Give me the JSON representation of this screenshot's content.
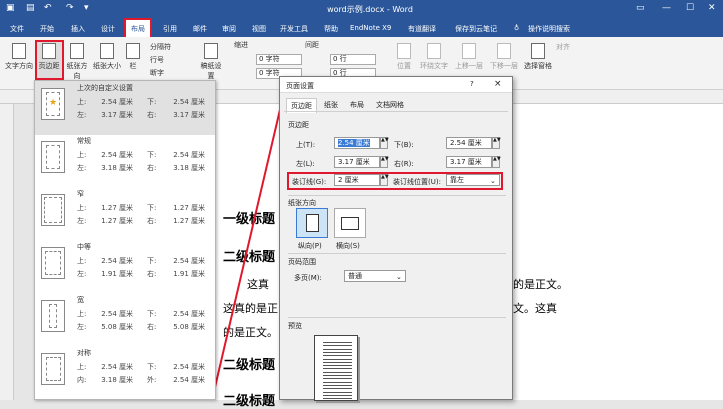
{
  "window": {
    "title": "word示例.docx  -  Word"
  },
  "tabs": [
    "文件",
    "开始",
    "插入",
    "设计",
    "布局",
    "引用",
    "邮件",
    "审阅",
    "视图",
    "开发工具",
    "帮助",
    "EndNote X9",
    "有道翻译",
    "保存到云笔记",
    "操作说明搜索"
  ],
  "active_tab": "布局",
  "ribbon": {
    "text_direction": "文字方向",
    "margins": "页边距",
    "orientation": "纸张方向",
    "size": "纸张大小",
    "columns": "栏",
    "breaks": "分隔符",
    "line_numbers": "行号",
    "hyphenation": "断字",
    "manuscript": "稿纸设置",
    "indent": "缩进",
    "spacing": "间距",
    "indent_left": "0 字符",
    "indent_right": "0 字符",
    "spacing_before": "0 行",
    "spacing_after": "0 行",
    "position": "位置",
    "wrap": "环绕文字",
    "bring_forward": "上移一层",
    "send_backward": "下移一层",
    "selection_pane": "选择窗格",
    "align": "对齐"
  },
  "margin_presets": [
    {
      "name": "上次的自定义设置",
      "top_l": "上:",
      "top": "2.54 厘米",
      "bottom_l": "下:",
      "bottom": "2.54 厘米",
      "left_l": "左:",
      "left": "3.17 厘米",
      "right_l": "右:",
      "right": "3.17 厘米"
    },
    {
      "name": "常规",
      "top_l": "上:",
      "top": "2.54 厘米",
      "bottom_l": "下:",
      "bottom": "2.54 厘米",
      "left_l": "左:",
      "left": "3.18 厘米",
      "right_l": "右:",
      "right": "3.18 厘米"
    },
    {
      "name": "窄",
      "top_l": "上:",
      "top": "1.27 厘米",
      "bottom_l": "下:",
      "bottom": "1.27 厘米",
      "left_l": "左:",
      "left": "1.27 厘米",
      "right_l": "右:",
      "right": "1.27 厘米"
    },
    {
      "name": "中等",
      "top_l": "上:",
      "top": "2.54 厘米",
      "bottom_l": "下:",
      "bottom": "2.54 厘米",
      "left_l": "左:",
      "left": "1.91 厘米",
      "right_l": "右:",
      "right": "1.91 厘米"
    },
    {
      "name": "宽",
      "top_l": "上:",
      "top": "2.54 厘米",
      "bottom_l": "下:",
      "bottom": "2.54 厘米",
      "left_l": "左:",
      "left": "5.08 厘米",
      "right_l": "右:",
      "right": "5.08 厘米"
    },
    {
      "name": "对称",
      "top_l": "上:",
      "top": "2.54 厘米",
      "bottom_l": "下:",
      "bottom": "2.54 厘米",
      "left_l": "内:",
      "left": "3.18 厘米",
      "right_l": "外:",
      "right": "2.54 厘米"
    }
  ],
  "dialog": {
    "title": "页面设置",
    "help": "?",
    "close": "×",
    "tabs": [
      "页边距",
      "纸张",
      "布局",
      "文档网格"
    ],
    "margins_group": "页边距",
    "top_label": "上(T):",
    "top_value": "2.54 厘米",
    "bottom_label": "下(B):",
    "bottom_value": "2.54 厘米",
    "left_label": "左(L):",
    "left_value": "3.17 厘米",
    "right_label": "右(R):",
    "right_value": "3.17 厘米",
    "gutter_label": "装订线(G):",
    "gutter_value": "2 厘米",
    "gutter_pos_label": "装订线位置(U):",
    "gutter_pos_value": "靠左",
    "orientation_group": "纸张方向",
    "portrait": "纵向(P)",
    "landscape": "横向(S)",
    "pages_group": "页码范围",
    "multi_label": "多页(M):",
    "multi_value": "普通",
    "preview_group": "预览"
  },
  "document": {
    "h1": "一级标题",
    "h2a": "二级标题",
    "line1": "这真",
    "line1_tail": "的是正文。",
    "line2": "这真的是正",
    "line2_tail": "文。这真",
    "line3": "的是正文。",
    "h2b": "二级标题",
    "h2c": "二级标题"
  }
}
